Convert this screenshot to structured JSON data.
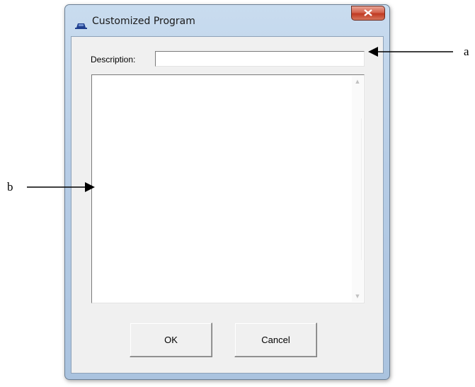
{
  "window": {
    "title": "Customized Program",
    "close_symbol": "x"
  },
  "form": {
    "description_label": "Description:",
    "description_value": "",
    "program_text": ""
  },
  "buttons": {
    "ok_label": "OK",
    "cancel_label": "Cancel"
  },
  "annotations": {
    "a_label": "a",
    "b_label": "b"
  },
  "icons": {
    "app": "app-icon",
    "close": "close-icon",
    "scroll_up": "scroll-up-icon",
    "scroll_down": "scroll-down-icon",
    "arrow_a": "arrow-left-icon",
    "arrow_b": "arrow-right-icon"
  },
  "colors": {
    "frame": "#b7cde6",
    "close_button": "#c03a22",
    "dialog_background": "#f0f0f0",
    "app_icon": "#1f3f8f"
  }
}
